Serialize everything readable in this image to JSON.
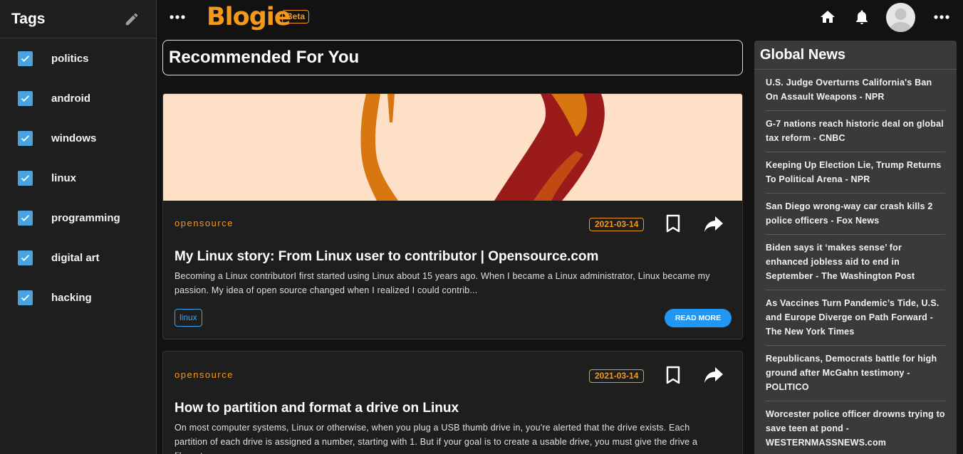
{
  "sidebar": {
    "title": "Tags",
    "tags": [
      {
        "label": "politics",
        "checked": true
      },
      {
        "label": "android",
        "checked": true
      },
      {
        "label": "windows",
        "checked": true
      },
      {
        "label": "linux",
        "checked": true
      },
      {
        "label": "programming",
        "checked": true
      },
      {
        "label": "digital art",
        "checked": true
      },
      {
        "label": "hacking",
        "checked": true
      }
    ]
  },
  "topbar": {
    "logo": "Blogie",
    "beta": "Beta"
  },
  "main": {
    "section_title": "Recommended For You",
    "cards": [
      {
        "source": "opensource",
        "date": "2021-03-14",
        "title": "My Linux story: From Linux user to contributor | Opensource.com",
        "description": "Becoming a Linux contributorI first started using Linux about 15 years ago. When I became a Linux administrator, Linux became my passion. My idea of open source changed when I realized I could contrib...",
        "tag": "linux",
        "read_more": "READ MORE"
      },
      {
        "source": "opensource",
        "date": "2021-03-14",
        "title": "How to partition and format a drive on Linux",
        "description": "On most computer systems, Linux or otherwise, when you plug a USB thumb drive in, you're alerted that the drive exists. Each partition of each drive is assigned a number, starting with 1. But if your goal is to create a usable drive, you must give the drive a filesystem."
      }
    ]
  },
  "news": {
    "title": "Global News",
    "items": [
      "U.S. Judge Overturns California's Ban On Assault Weapons - NPR",
      "G-7 nations reach historic deal on global tax reform - CNBC",
      "Keeping Up Election Lie, Trump Returns To Political Arena - NPR",
      "San Diego wrong-way car crash kills 2 police officers - Fox News",
      "Biden says it ‘makes sense’ for enhanced jobless aid to end in September - The Washington Post",
      "As Vaccines Turn Pandemic’s Tide, U.S. and Europe Diverge on Path Forward - The New York Times",
      "Republicans, Democrats battle for high ground after McGahn testimony - POLITICO",
      "Worcester police officer drowns trying to save teen at pond - WESTERNMASSNEWS.com"
    ]
  },
  "colors": {
    "accent": "#f39a1c",
    "checkbox": "#4aa3df",
    "button": "#2196f3"
  }
}
